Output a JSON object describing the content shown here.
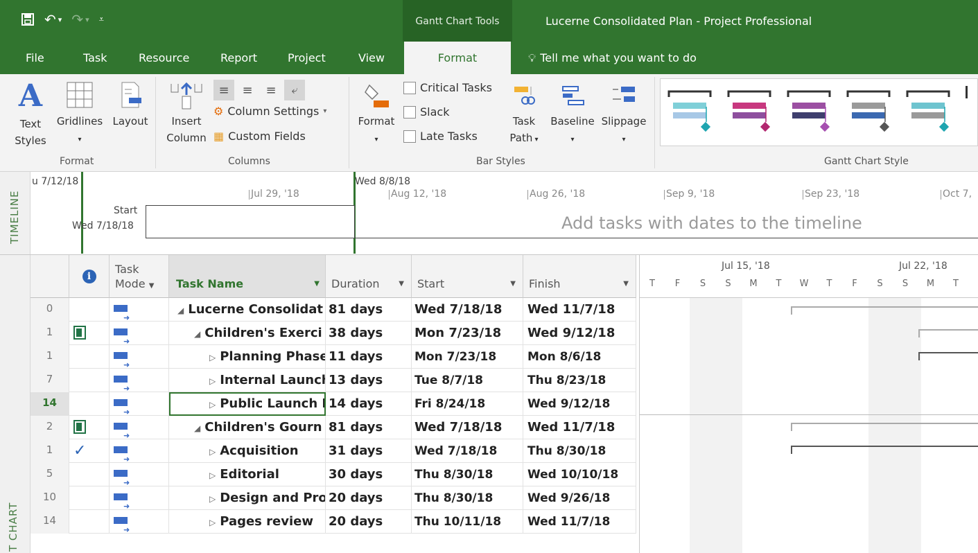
{
  "title_bar": {
    "context_tab": "Gantt Chart Tools",
    "app_title": "Lucerne Consolidated Plan - Project Professional"
  },
  "ribbon_tabs": [
    "File",
    "Task",
    "Resource",
    "Report",
    "Project",
    "View",
    "Format"
  ],
  "active_tab": "Format",
  "tell_me": "Tell me what you want to do",
  "ribbon": {
    "format_group": {
      "label": "Format",
      "text_styles_l1": "Text",
      "text_styles_l2": "Styles",
      "gridlines": "Gridlines",
      "layout": "Layout"
    },
    "columns_group": {
      "label": "Columns",
      "insert_l1": "Insert",
      "insert_l2": "Column",
      "column_settings": "Column Settings",
      "custom_fields": "Custom Fields"
    },
    "bar_styles_group": {
      "label": "Bar Styles",
      "format": "Format",
      "critical_tasks": "Critical Tasks",
      "slack": "Slack",
      "late_tasks": "Late Tasks",
      "task_path_l1": "Task",
      "task_path_l2": "Path",
      "baseline": "Baseline",
      "slippage": "Slippage"
    },
    "gantt_chart_style": {
      "label": "Gantt Chart Style",
      "styles": [
        {
          "bar": "#7fcfd8",
          "bar2": "#a7c8e6",
          "accent": "#1ea5b0"
        },
        {
          "bar": "#c8387f",
          "bar2": "#8e4f9e",
          "accent": "#b2266f"
        },
        {
          "bar": "#9b4fa2",
          "bar2": "#3f3f6e",
          "accent": "#a64fb0"
        },
        {
          "bar": "#9a9a9a",
          "bar2": "#3b69b1",
          "accent": "#555555"
        },
        {
          "bar": "#6ec4cf",
          "bar2": "#9a9a9a",
          "accent": "#1ea5b0"
        }
      ]
    }
  },
  "timeline": {
    "side_label": "TIMELINE",
    "left_date": "u 7/12/18",
    "today_marker": "Wed 8/8/18",
    "start_label": "Start",
    "start_date": "Wed 7/18/18",
    "ticks": [
      "Jul 29, '18",
      "Aug 12, '18",
      "Aug 26, '18",
      "Sep 9, '18",
      "Sep 23, '18",
      "Oct 7,"
    ],
    "placeholder": "Add tasks with dates to the timeline"
  },
  "grid": {
    "side_label": "T CHART",
    "headers": {
      "mode_l1": "Task",
      "mode_l2": "Mode",
      "name": "Task Name",
      "duration": "Duration",
      "start": "Start",
      "finish": "Finish"
    },
    "rows": [
      {
        "id": "0",
        "info": "",
        "name": "Lucerne Consolidat",
        "indent": 0,
        "summary": true,
        "duration": "81 days",
        "start": "Wed 7/18/18",
        "finish": "Wed 11/7/18"
      },
      {
        "id": "1",
        "info": "note",
        "name": "Children's Exerci",
        "indent": 1,
        "summary": true,
        "duration": "38 days",
        "start": "Mon 7/23/18",
        "finish": "Wed 9/12/18"
      },
      {
        "id": "1",
        "info": "",
        "name": "Planning Phase",
        "indent": 2,
        "summary": false,
        "duration": "11 days",
        "start": "Mon 7/23/18",
        "finish": "Mon 8/6/18"
      },
      {
        "id": "7",
        "info": "",
        "name": "Internal Launch",
        "indent": 2,
        "summary": false,
        "duration": "13 days",
        "start": "Tue 8/7/18",
        "finish": "Thu 8/23/18"
      },
      {
        "id": "14",
        "info": "",
        "name": "Public Launch P",
        "indent": 2,
        "summary": false,
        "duration": "14 days",
        "start": "Fri 8/24/18",
        "finish": "Wed 9/12/18",
        "selected": true
      },
      {
        "id": "2",
        "info": "note",
        "name": "Children's Gourn",
        "indent": 1,
        "summary": true,
        "duration": "81 days",
        "start": "Wed 7/18/18",
        "finish": "Wed 11/7/18"
      },
      {
        "id": "1",
        "info": "check",
        "name": "Acquisition",
        "indent": 2,
        "summary": false,
        "duration": "31 days",
        "start": "Wed 7/18/18",
        "finish": "Thu 8/30/18"
      },
      {
        "id": "5",
        "info": "",
        "name": "Editorial",
        "indent": 2,
        "summary": false,
        "duration": "30 days",
        "start": "Thu 8/30/18",
        "finish": "Wed 10/10/18"
      },
      {
        "id": "10",
        "info": "",
        "name": "Design and Proc",
        "indent": 2,
        "summary": false,
        "duration": "20 days",
        "start": "Thu 8/30/18",
        "finish": "Wed 9/26/18"
      },
      {
        "id": "14",
        "info": "",
        "name": "Pages review",
        "indent": 2,
        "summary": false,
        "duration": "20 days",
        "start": "Thu 10/11/18",
        "finish": "Wed 11/7/18"
      }
    ]
  },
  "gantt": {
    "weeks": [
      "Jul 15, '18",
      "Jul 22, '18"
    ],
    "days": [
      "T",
      "F",
      "S",
      "S",
      "M",
      "T",
      "W",
      "T",
      "F",
      "S",
      "S",
      "M",
      "T"
    ]
  }
}
